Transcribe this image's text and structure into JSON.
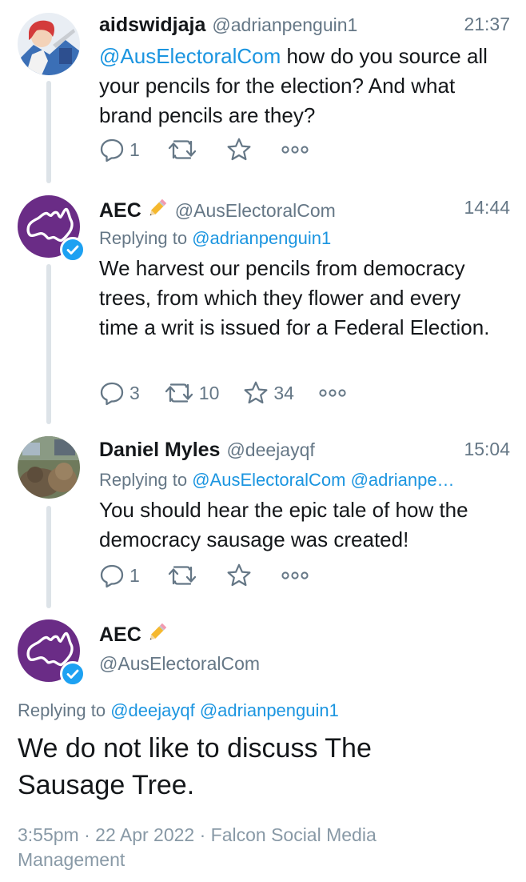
{
  "tweets": [
    {
      "name": "aidswidjaja",
      "handle": "@adrianpenguin1",
      "time": "21:37",
      "mention": "@AusElectoralCom",
      "text": " how do you source all your pencils for the election? And what brand pencils are they?",
      "replies": "1",
      "retweets": "",
      "likes": ""
    },
    {
      "name": "AEC",
      "handle": "@AusElectoralCom",
      "time": "14:44",
      "replying_label": "Replying to",
      "replying_to": "@adrianpenguin1",
      "text": "We harvest our pencils from democracy trees, from which they flower and every time a writ is issued for a Federal Election.",
      "replies": "3",
      "retweets": "10",
      "likes": "34"
    },
    {
      "name": "Daniel Myles",
      "handle": "@deejayqf",
      "time": "15:04",
      "replying_label": "Replying to",
      "replying_to": "@AusElectoralCom @adrianpe…",
      "text": "You should hear the epic tale of how the democracy sausage was created!",
      "replies": "1",
      "retweets": "",
      "likes": ""
    }
  ],
  "main_tweet": {
    "name": "AEC",
    "handle": "@AusElectoralCom",
    "replying_label": "Replying to",
    "replying_to": "@deejayqf @adrianpenguin1",
    "text": "We do not like to discuss The Sausage Tree.",
    "meta_line1": "3:55pm · 22 Apr 2022 · Falcon Social Media",
    "meta_line2": "Management"
  },
  "icons": {
    "reply": "reply-icon",
    "retweet": "retweet-icon",
    "like": "heart-icon",
    "more": "more-icon",
    "verified": "verified-badge-icon",
    "pencil": "pencil-emoji-icon"
  },
  "colors": {
    "link": "#1b95e0",
    "muted": "#657786",
    "aec_purple": "#6a2c86",
    "verified": "#1da1f2",
    "thread_line": "#dde3e8"
  }
}
